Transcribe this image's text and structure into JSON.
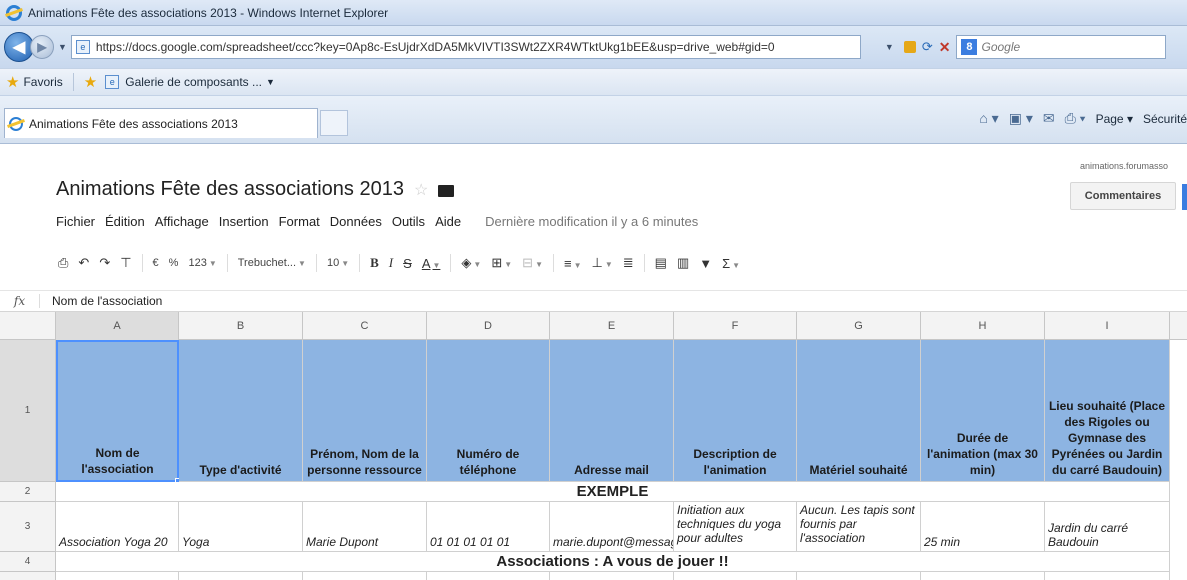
{
  "browser": {
    "window_title": "Animations Fête des associations 2013 - Windows Internet Explorer",
    "url": "https://docs.google.com/spreadsheet/ccc?key=0Ap8c-EsUjdrXdDA5MkVIVTI3SWt2ZXR4WTktUkg1bEE&usp=drive_web#gid=0",
    "search_placeholder": "Google",
    "favorites_label": "Favoris",
    "fav_link": "Galerie de composants ...",
    "tab_title": "Animations Fête des associations 2013",
    "cmd_page": "Page",
    "cmd_security": "Sécurité"
  },
  "doc": {
    "title": "Animations Fête des associations 2013",
    "user_email": "animations.forumasso",
    "comments_label": "Commentaires",
    "menu": [
      "Fichier",
      "Édition",
      "Affichage",
      "Insertion",
      "Format",
      "Données",
      "Outils",
      "Aide"
    ],
    "last_modified": "Dernière modification il y a 6 minutes"
  },
  "toolbar": {
    "currency": "€",
    "percent": "%",
    "number_format": "123",
    "font": "Trebuchet...",
    "font_size": "10",
    "bold": "B",
    "italic": "I",
    "strike": "S",
    "text_color": "A",
    "sigma": "Σ"
  },
  "formula_bar": {
    "fx": "fx",
    "value": "Nom de l'association"
  },
  "grid": {
    "columns": [
      "A",
      "B",
      "C",
      "D",
      "E",
      "F",
      "G",
      "H",
      "I"
    ],
    "rows": [
      "1",
      "2",
      "3",
      "4"
    ],
    "header_row": [
      "Nom de l'association",
      "Type d'activité",
      "Prénom, Nom de la personne ressource",
      "Numéro de téléphone",
      "Adresse mail",
      "Description de l'animation",
      "Matériel souhaité",
      "Durée de l'animation (max 30 min)",
      "Lieu souhaité (Place des Rigoles ou Gymnase des Pyrénées ou Jardin du carré Baudouin)"
    ],
    "example_label": "EXEMPLE",
    "example_row": [
      "Association Yoga 20",
      "Yoga",
      "Marie Dupont",
      "01 01 01 01 01",
      "marie.dupont@messagerie.fr",
      "Initiation aux techniques du yoga pour adultes",
      "Aucun. Les tapis sont fournis par l'association",
      "25 min",
      "Jardin du carré Baudouin"
    ],
    "call_to_action": "Associations : A vous de jouer !!"
  }
}
